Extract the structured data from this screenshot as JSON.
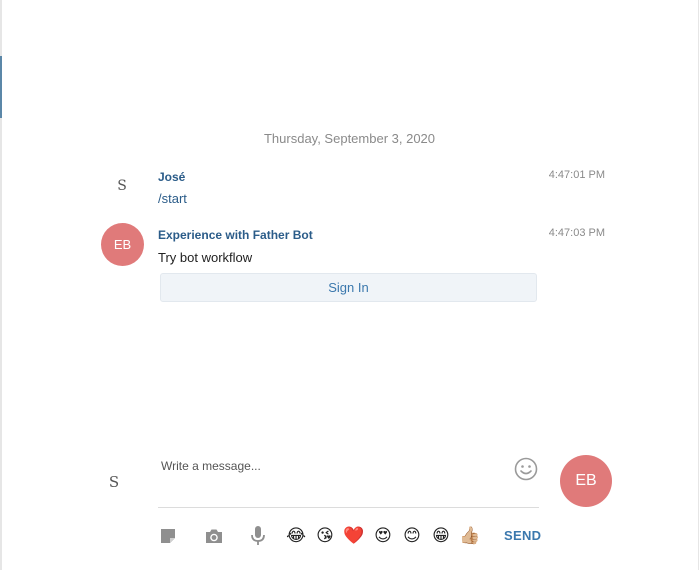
{
  "conversation": {
    "date_separator": "Thursday, September 3, 2020",
    "messages": [
      {
        "avatar": "S",
        "sender": "José",
        "time": "4:47:01 PM",
        "text": "/start"
      },
      {
        "avatar": "EB",
        "sender": "Experience with Father Bot",
        "time": "4:47:03 PM",
        "text": "Try bot workflow",
        "button_label": "Sign In"
      }
    ]
  },
  "composer": {
    "user_avatar": "S",
    "placeholder": "Write a message...",
    "bot_avatar": "EB",
    "send_label": "SEND",
    "tools": [
      "file-icon",
      "camera-icon",
      "microphone-icon"
    ],
    "emojis": [
      "😂",
      "😘",
      "❤️",
      "😍",
      "😊",
      "😁",
      "👍🏼"
    ]
  },
  "colors": {
    "accent": "#3b78ad",
    "sender": "#2b5c89",
    "avatar_bg": "#e07a7a",
    "side_accent": "#5b87a8"
  }
}
